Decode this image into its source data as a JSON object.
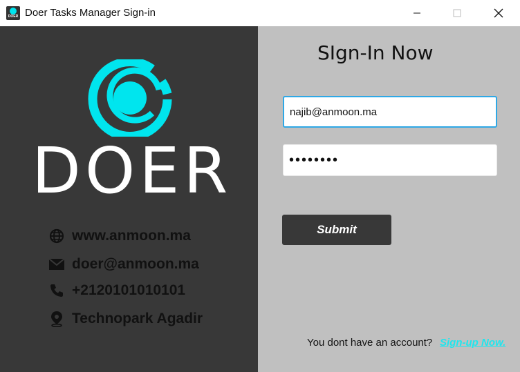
{
  "window": {
    "title": "Doer Tasks Manager Sign-in",
    "icon_text": "DOER",
    "controls": {
      "minimize": "—",
      "maximize": "☐",
      "close": "✕"
    }
  },
  "brand": {
    "name": "DOER",
    "accent_color": "#00e5ee"
  },
  "contacts": [
    {
      "icon": "globe-icon",
      "text": "www.anmoon.ma"
    },
    {
      "icon": "mail-icon",
      "text": "doer@anmoon.ma"
    },
    {
      "icon": "phone-icon",
      "text": "+2120101010101"
    },
    {
      "icon": "location-pin-icon",
      "text": "Technopark Agadir"
    }
  ],
  "form": {
    "heading": "SIgn-In Now",
    "email_value": "najib@anmoon.ma",
    "password_value": "••••••••",
    "submit_label": "Submit",
    "no_account_text": "You dont have an account?",
    "signup_label": "Sign-up Now."
  },
  "colors": {
    "left_panel": "#383838",
    "right_panel": "#c0c0c0",
    "link": "#1ee6ee",
    "focus_border": "#2ea8e6"
  }
}
